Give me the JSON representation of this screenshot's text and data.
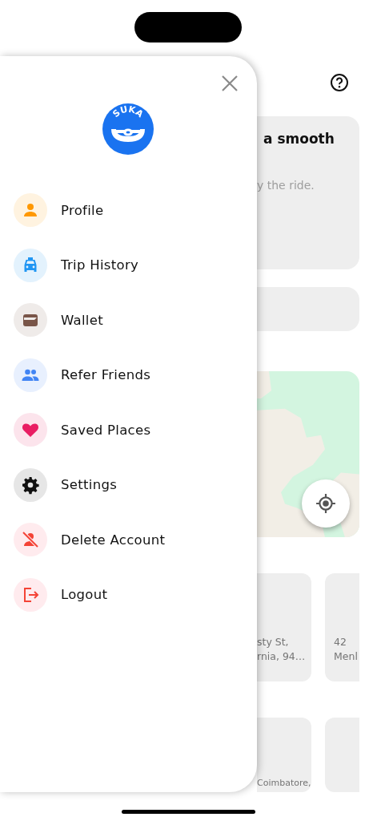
{
  "background": {
    "hero_card": {
      "title": "a smooth",
      "subtitle": "y the ride."
    },
    "places_row_1": [
      {
        "line_1": "sty St,",
        "line_2": "rnia, 94…"
      },
      {
        "line_1": "42",
        "line_2": "Menl"
      }
    ],
    "places_row_2": [
      {
        "line_1": "Coimbatore,"
      }
    ]
  },
  "drawer": {
    "logo": {
      "text": "SUKA"
    },
    "items": [
      {
        "label": "Profile",
        "kind": "profile"
      },
      {
        "label": "Trip History",
        "kind": "taxi"
      },
      {
        "label": "Wallet",
        "kind": "wallet"
      },
      {
        "label": "Refer Friends",
        "kind": "people"
      },
      {
        "label": "Saved Places",
        "kind": "heart"
      },
      {
        "label": "Settings",
        "kind": "gear"
      },
      {
        "label": "Delete Account",
        "kind": "person-off"
      },
      {
        "label": "Logout",
        "kind": "logout"
      }
    ]
  }
}
